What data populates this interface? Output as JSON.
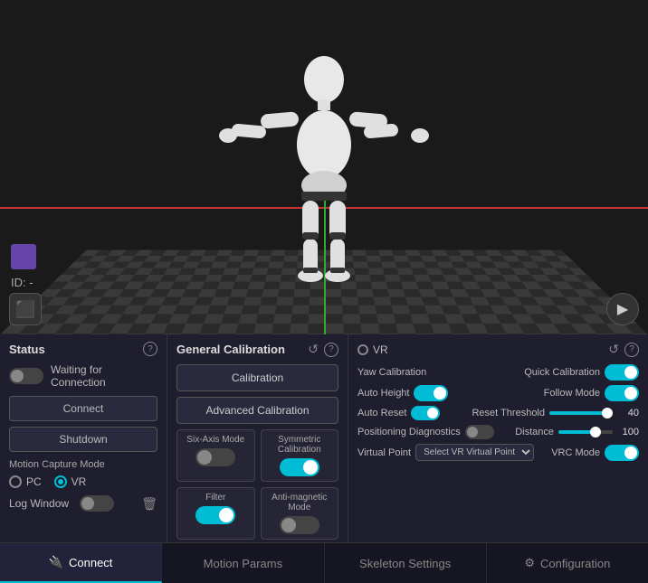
{
  "viewport": {
    "id_label": "ID: -"
  },
  "panels": {
    "left": {
      "title": "Status",
      "waiting_text": "Waiting for Connection",
      "connect_label": "Connect",
      "shutdown_label": "Shutdown",
      "motion_capture_mode": "Motion Capture Mode",
      "pc_label": "PC",
      "vr_label": "VR",
      "log_window_label": "Log Window"
    },
    "middle": {
      "title": "General Calibration",
      "calibration_label": "Calibration",
      "advanced_calibration_label": "Advanced Calibration",
      "six_axis_label": "Six-Axis Mode",
      "symmetric_label": "Symmetric Calibration",
      "filter_label": "Filter",
      "anti_magnetic_label": "Anti-magnetic Mode"
    },
    "right": {
      "vr_label": "VR",
      "yaw_calibration_label": "Yaw Calibration",
      "quick_calibration_label": "Quick Calibration",
      "auto_height_label": "Auto Height",
      "follow_mode_label": "Follow Mode",
      "auto_reset_label": "Auto Reset",
      "reset_threshold_label": "Reset Threshold",
      "reset_threshold_value": "40",
      "positioning_diagnostics_label": "Positioning Diagnostics",
      "distance_label": "Distance",
      "distance_value": "100",
      "virtual_point_label": "Virtual Point",
      "select_vr_virtual_point": "Select VR Virtual Point",
      "vrc_mode_label": "VRC Mode"
    }
  },
  "tabs": [
    {
      "id": "connect",
      "label": "Connect",
      "icon": "plug-icon",
      "active": true
    },
    {
      "id": "motion-params",
      "label": "Motion Params",
      "icon": null,
      "active": false
    },
    {
      "id": "skeleton-settings",
      "label": "Skeleton Settings",
      "icon": null,
      "active": false
    },
    {
      "id": "configuration",
      "label": "Configuration",
      "icon": "gear-icon",
      "active": false
    }
  ],
  "icons": {
    "info": "?",
    "refresh": "↺",
    "cube": "⬛",
    "play": "▶",
    "gear": "⚙",
    "plug": "🔌",
    "trash": "🗑"
  }
}
